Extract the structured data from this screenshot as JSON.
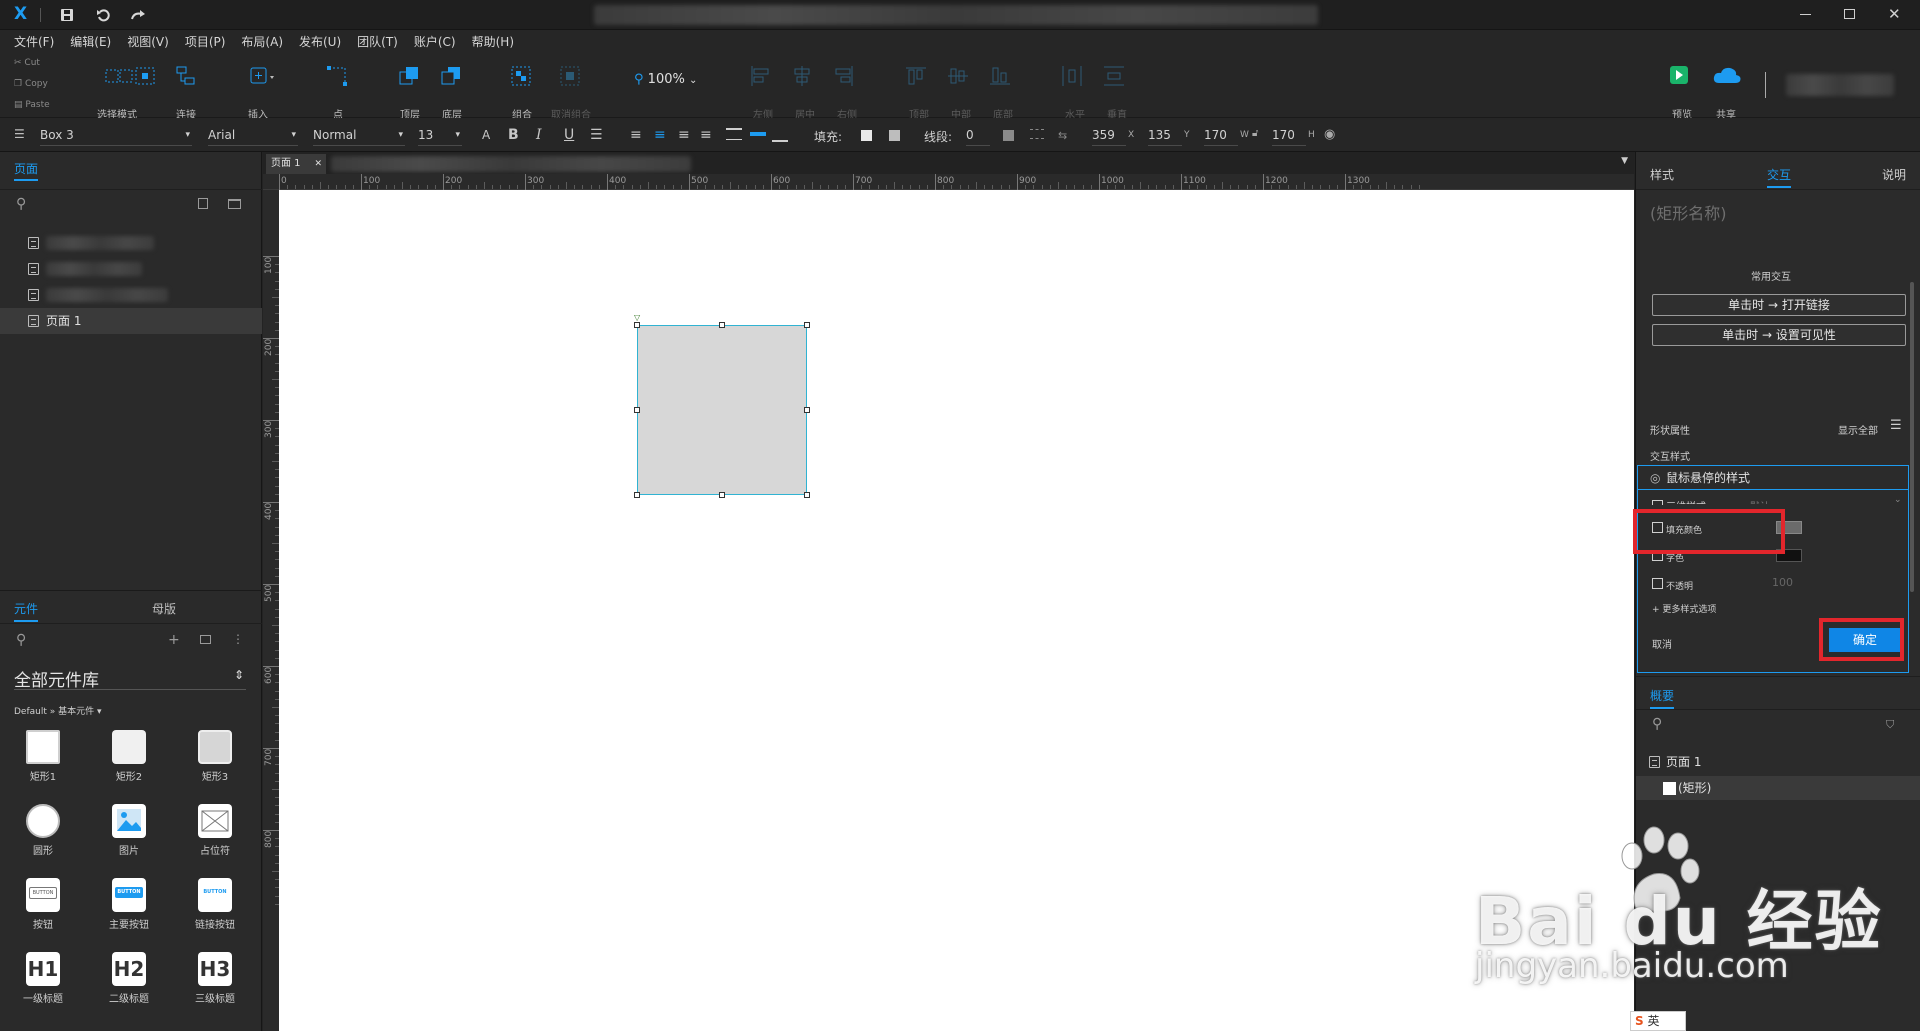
{
  "window": {
    "logo": "X",
    "controls": [
      "minimize-icon",
      "maximize-icon",
      "close-icon"
    ]
  },
  "menu": [
    "文件(F)",
    "编辑(E)",
    "视图(V)",
    "项目(P)",
    "布局(A)",
    "发布(U)",
    "团队(T)",
    "账户(C)",
    "帮助(H)"
  ],
  "clipboard": {
    "cut": "Cut",
    "copy": "Copy",
    "paste": "Paste"
  },
  "toolbar": {
    "select_mode": "选择模式",
    "connect": "连接",
    "insert": "插入",
    "point": "点",
    "top": "顶层",
    "bottom": "底层",
    "group": "组合",
    "ungroup": "取消组合",
    "zoom": "100%",
    "left": "左侧",
    "center": "居中",
    "right": "右侧",
    "top_align": "顶部",
    "middle": "中部",
    "bottom_align": "底部",
    "horizontal": "水平",
    "vertical": "垂直",
    "preview": "预览",
    "share": "共享"
  },
  "format": {
    "element_name": "Box 3",
    "font": "Arial",
    "weight": "Normal",
    "size": "13",
    "fill_label": "填充:",
    "line_label": "线段:",
    "line_value": "0",
    "x": "359",
    "x_label": "X",
    "y": "135",
    "y_label": "Y",
    "w": "170",
    "w_label": "W",
    "h": "170",
    "h_label": "H"
  },
  "pages_panel": {
    "tab": "页面",
    "current_page": "页面 1"
  },
  "library_panel": {
    "tab_widgets": "元件",
    "tab_masters": "母版",
    "library": "全部元件库",
    "sublibrary": "Default » 基本元件 ▾",
    "widgets": [
      {
        "label": "矩形1"
      },
      {
        "label": "矩形2"
      },
      {
        "label": "矩形3"
      },
      {
        "label": "圆形"
      },
      {
        "label": "图片"
      },
      {
        "label": "占位符"
      },
      {
        "label": "按钮",
        "text": "BUTTON"
      },
      {
        "label": "主要按钮",
        "text": "BUTTON"
      },
      {
        "label": "链接按钮",
        "text": "BUTTON"
      },
      {
        "label": "一级标题",
        "text": "H1"
      },
      {
        "label": "二级标题",
        "text": "H2"
      },
      {
        "label": "三级标题",
        "text": "H3"
      }
    ]
  },
  "canvas": {
    "tab": "页面 1",
    "ruler_top": [
      "0",
      "100",
      "200",
      "300",
      "400",
      "500",
      "600",
      "700",
      "800",
      "900",
      "1000",
      "1100",
      "1200",
      "1300"
    ],
    "ruler_left": [
      "100",
      "200",
      "300",
      "400",
      "500",
      "600",
      "700",
      "800"
    ]
  },
  "right_panel": {
    "tab_style": "样式",
    "tab_interaction": "交互",
    "tab_notes": "说明",
    "shape_name_placeholder": "(矩形名称)",
    "common_interactions": "常用交互",
    "btn_open_link": "单击时 → 打开链接",
    "btn_set_visibility": "单击时 → 设置可见性",
    "shape_props": "形状属性",
    "show_all": "显示全部",
    "interaction_styles": "交互样式",
    "hover_style": "鼠标悬停的样式",
    "partial_row": "三维样式",
    "partial_row_value": "默认",
    "fill_color": "填充颜色",
    "fill_color_value": "#6b6b6b",
    "text_color": "字色",
    "opacity": "不透明",
    "opacity_value": "100",
    "more_options": "+ 更多样式选项",
    "cancel": "取消",
    "confirm": "确定",
    "outline_tab": "概要",
    "outline_page": "页面 1",
    "outline_shape": "(矩形)"
  },
  "watermark": {
    "brand": "Bai du 经验",
    "url": "jingyan.baidu.com",
    "ime": "英"
  }
}
